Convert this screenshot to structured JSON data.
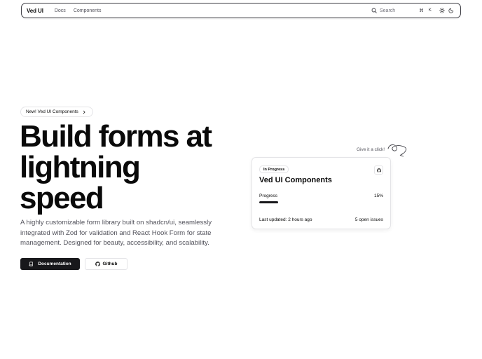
{
  "navbar": {
    "brand": "Ved UI",
    "links": [
      "Docs",
      "Components"
    ],
    "search": {
      "label": "Search",
      "shortcut_key": "⌘",
      "shortcut_letter": "K"
    },
    "icons": [
      "search-icon",
      "sun-icon",
      "moon-icon"
    ]
  },
  "hero": {
    "badge": "New! Ved UI Components",
    "headline": [
      "Build forms at",
      "lightning",
      "speed"
    ],
    "subtext": "A highly customizable form library built on shadcn/ui, seamlessly integrated with Zod for validation and React Hook Form for state management. Designed for beauty, accessibility, and scalability.",
    "primary_button": "Documentation",
    "secondary_button": "Github"
  },
  "card": {
    "hint": "Give it a click!",
    "status_badge": "In Progress",
    "title": "Ved UI Components",
    "progress_label": "Progress",
    "progress_text": "15%",
    "progress_fraction": 0.15,
    "last_updated": "Last updated: 2 hours ago",
    "open_issues": "5 open issues"
  },
  "colors": {
    "primary": "#18181b",
    "muted_text": "#52525b",
    "border": "#e4e4e7"
  }
}
